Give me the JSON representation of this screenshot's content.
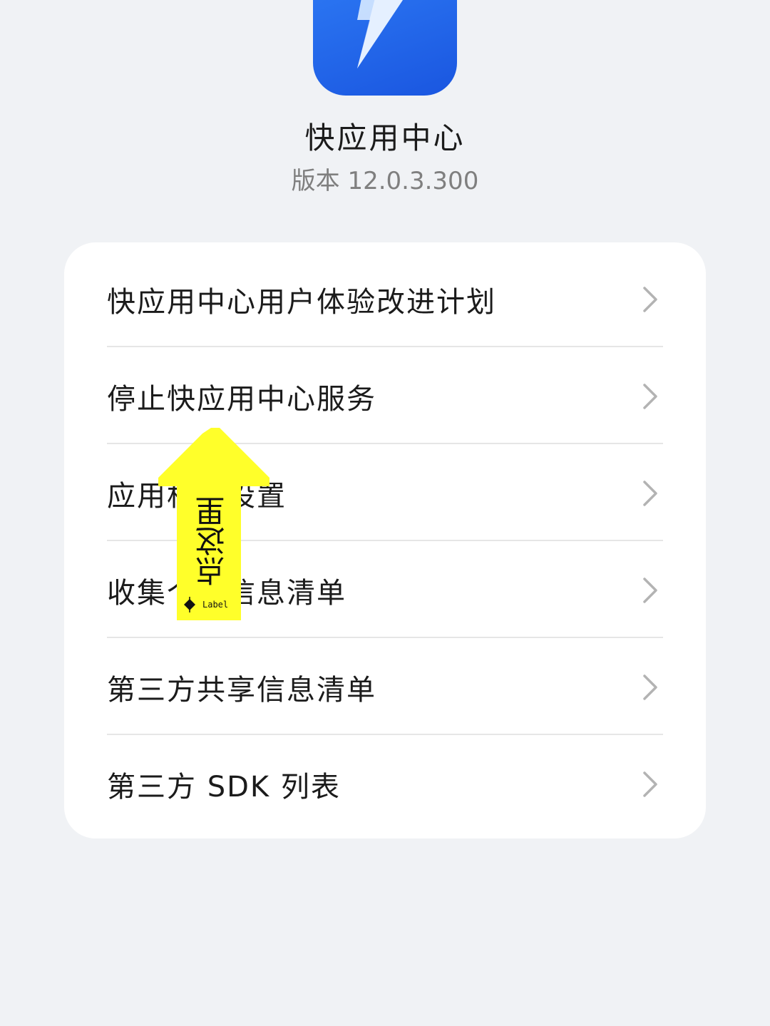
{
  "app": {
    "name": "快应用中心",
    "version": "版本 12.0.3.300"
  },
  "menu": {
    "items": [
      {
        "label": "快应用中心用户体验改进计划"
      },
      {
        "label": "停止快应用中心服务"
      },
      {
        "label": "应用相关设置"
      },
      {
        "label": "收集个人信息清单"
      },
      {
        "label": "第三方共享信息清单"
      },
      {
        "label": "第三方 SDK 列表"
      }
    ]
  },
  "overlay": {
    "text": "点这里",
    "label": "Label",
    "color": "#ffff2a"
  },
  "colors": {
    "background": "#f0f2f5",
    "card": "#ffffff",
    "icon_blue": "#1a56e0",
    "chevron": "#b3b3b3"
  }
}
